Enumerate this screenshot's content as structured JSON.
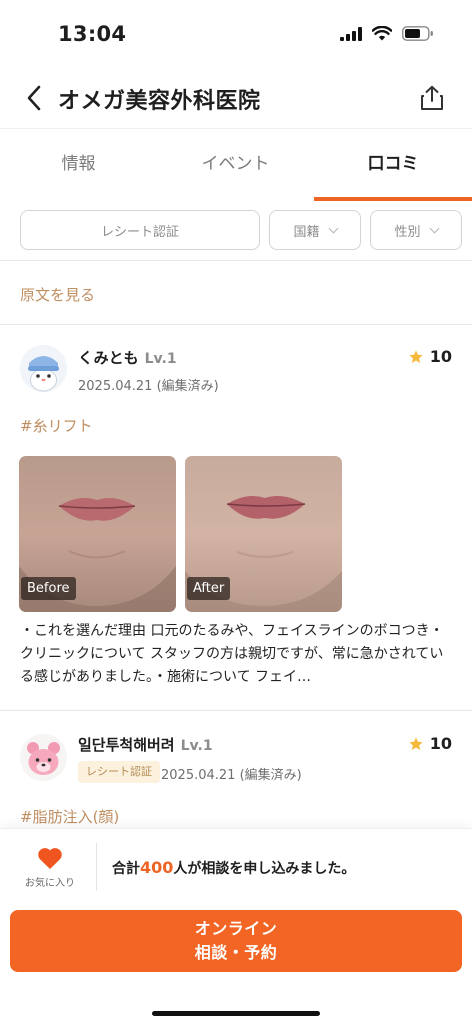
{
  "status_bar": {
    "time": "13:04"
  },
  "header": {
    "title": "オメガ美容外科医院"
  },
  "tabs": [
    {
      "label": "情報"
    },
    {
      "label": "イベント"
    },
    {
      "label": "口コミ"
    }
  ],
  "filters": {
    "receipt": "レシート認証",
    "nationality": "国籍",
    "gender": "性別"
  },
  "original_link": "原文を見る",
  "reviews": [
    {
      "user": "くみとも",
      "level": "Lv.1",
      "date": "2025.04.21 (編集済み)",
      "rating": "10",
      "hashtag": "#糸リフト",
      "photos": [
        {
          "label": "Before"
        },
        {
          "label": "After"
        }
      ],
      "text": "・これを選んだ理由 口元のたるみや、フェイスラインのボコつき・クリニックについて スタッフの方は親切ですが、常に急かされている感じがありました。・施術について フェイ…"
    },
    {
      "user": "일단투척해버려",
      "level": "Lv.1",
      "badge": "レシート認証",
      "date": "2025.04.21 (編集済み)",
      "rating": "10",
      "hashtag": "#脂肪注入(顔)"
    }
  ],
  "bottom": {
    "favorite_label": "お気に入り",
    "consult_prefix": "合計",
    "consult_count": "400",
    "consult_suffix": "人が相談を申し込みました。",
    "cta_line1": "オンライン",
    "cta_line2": "相談・予約"
  },
  "colors": {
    "accent": "#f26524",
    "star": "#f5b93b",
    "tag": "#bf8f62"
  }
}
